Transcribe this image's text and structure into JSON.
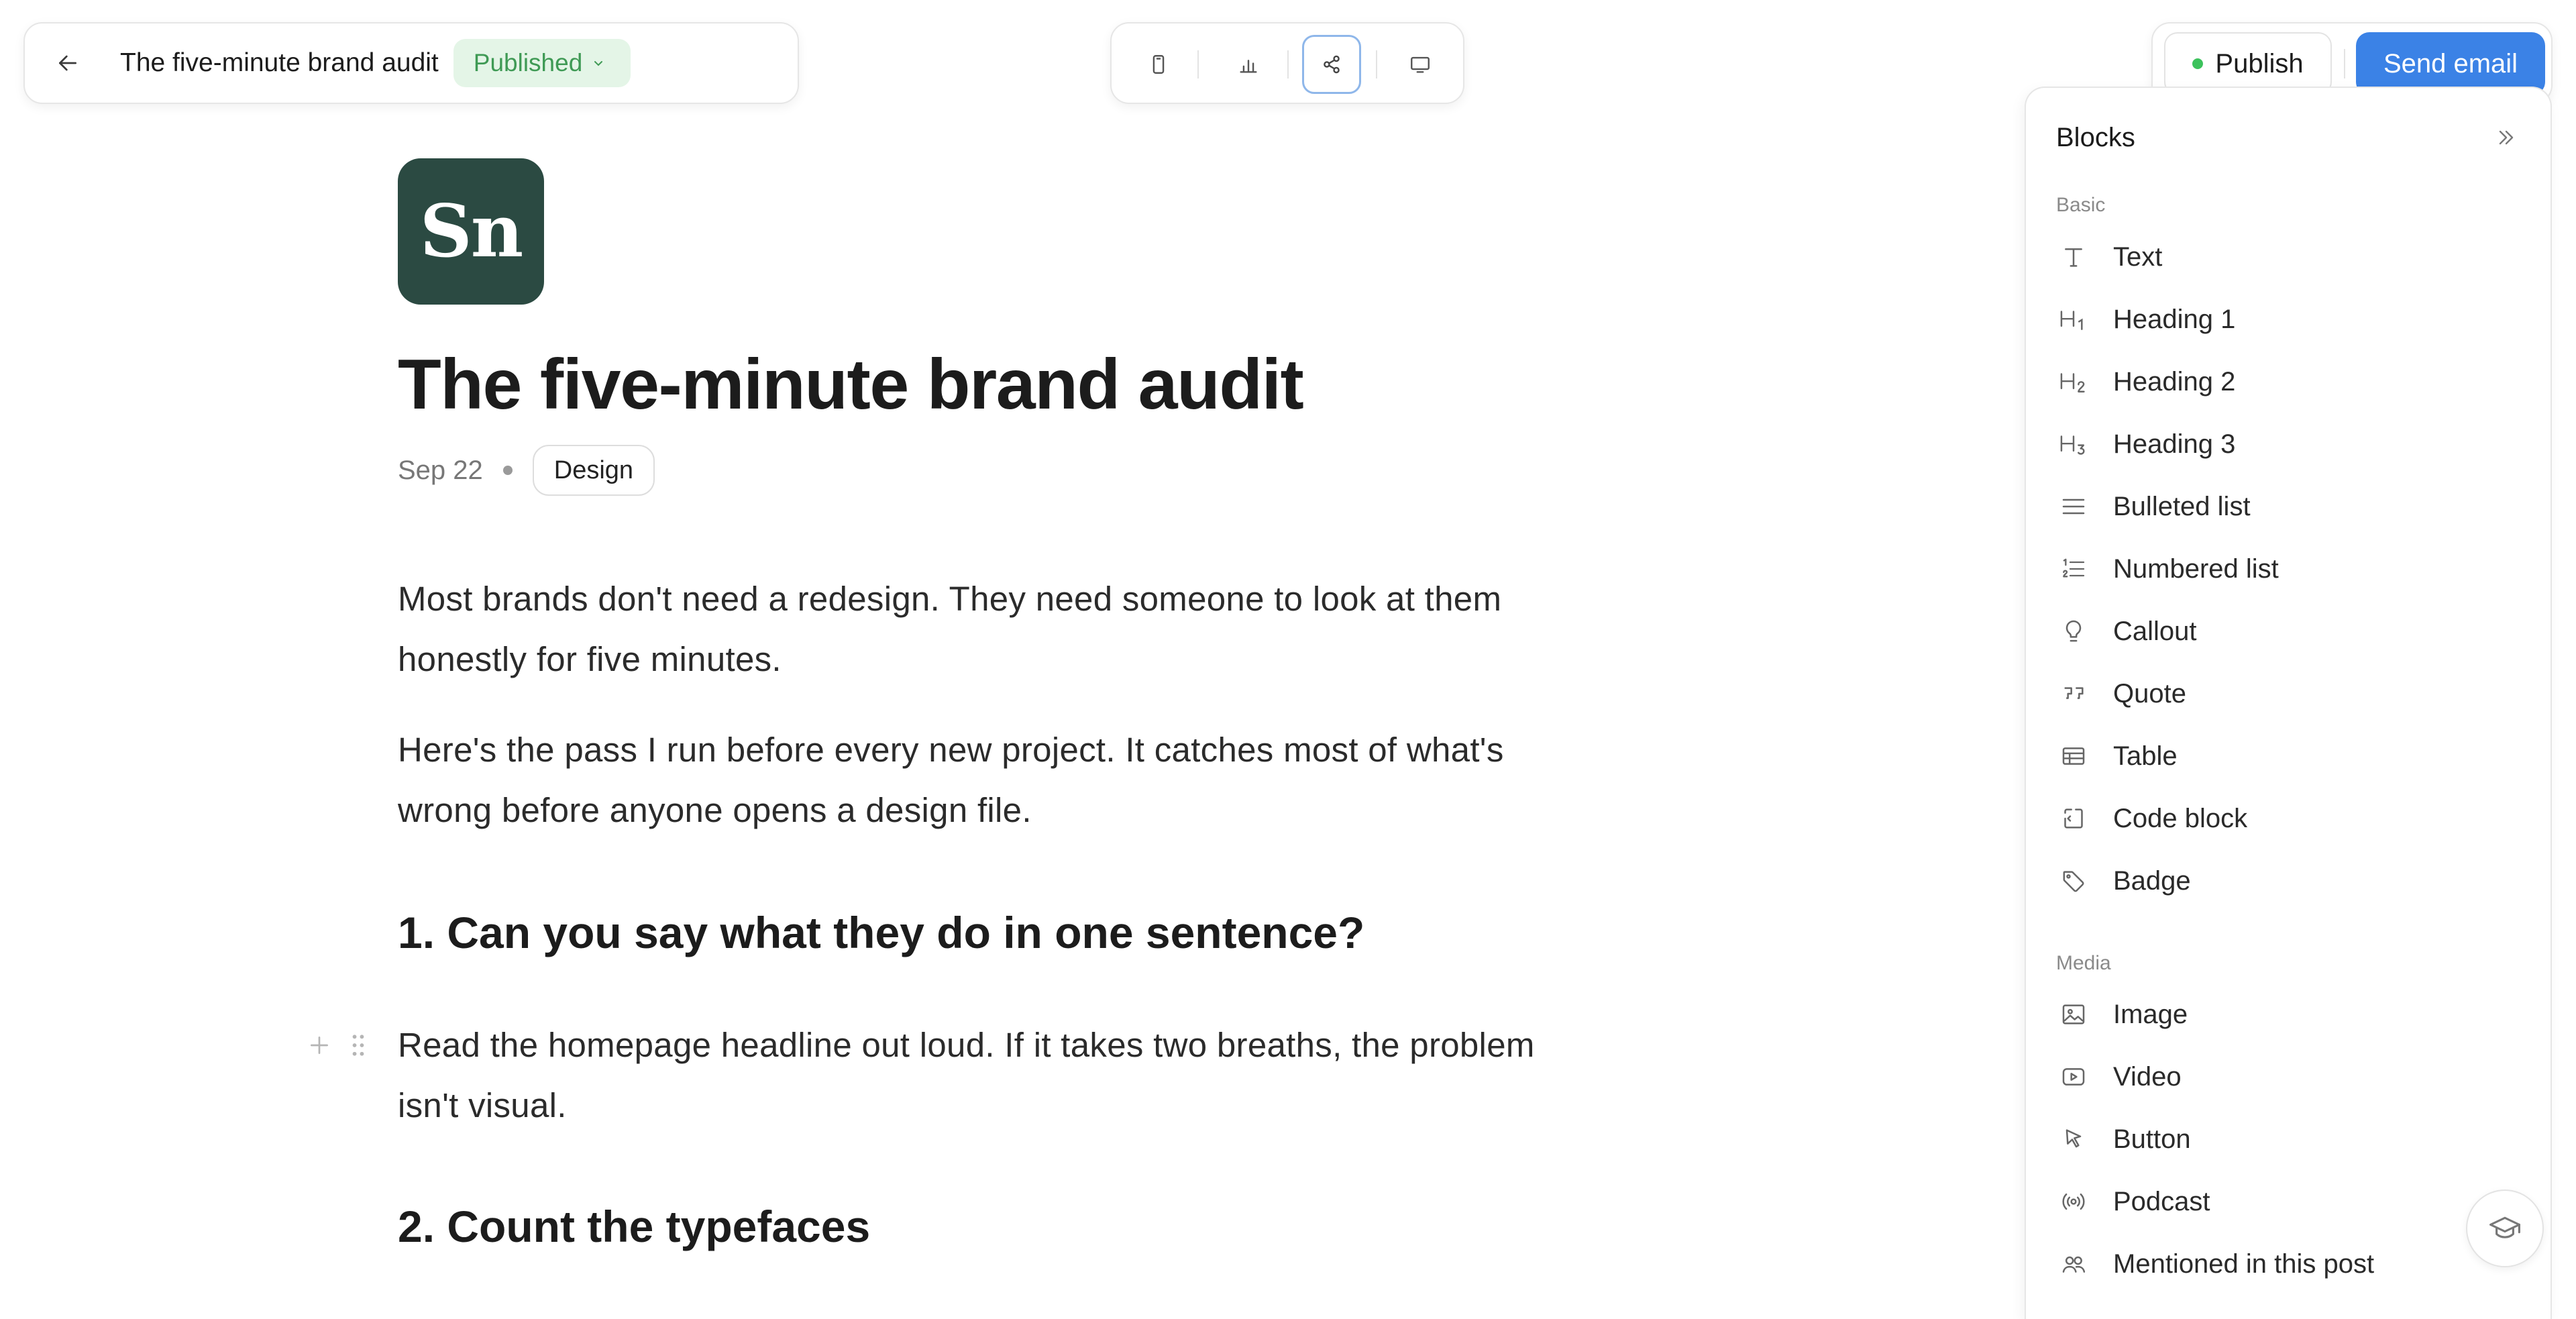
{
  "header": {
    "back_icon": "arrow-left-icon",
    "title": "The five-minute brand audit",
    "status": "Published"
  },
  "toolbar": {
    "buttons": [
      "mobile-preview-icon",
      "analytics-icon",
      "share-icon",
      "desktop-preview-icon"
    ],
    "active": "share-icon"
  },
  "actions": {
    "publish_label": "Publish",
    "send_label": "Send email",
    "accent_color": "#3b82e6",
    "live_color": "#3cc25c"
  },
  "post": {
    "logo_text": "Sn",
    "logo_color": "#2b4a42",
    "title": "The five-minute brand audit",
    "date": "Sep 22",
    "tag": "Design",
    "paragraph_1": "Most brands don't need a redesign. They need someone to look at them honestly for five minutes.",
    "paragraph_2": "Here's the pass I run before every new project. It catches most of what's wrong before anyone opens a design file.",
    "heading_1": "1. Can you say what they do in one sentence?",
    "paragraph_3": "Read the homepage headline out loud. If it takes two breaths, the problem isn't visual.",
    "heading_2": "2. Count the typefaces"
  },
  "blocks_panel": {
    "title": "Blocks",
    "basic_label": "Basic",
    "basic": [
      {
        "label": "Text",
        "icon": "text-icon"
      },
      {
        "label": "Heading 1",
        "icon": "heading-1-icon"
      },
      {
        "label": "Heading 2",
        "icon": "heading-2-icon"
      },
      {
        "label": "Heading 3",
        "icon": "heading-3-icon"
      },
      {
        "label": "Bulleted list",
        "icon": "bulleted-list-icon"
      },
      {
        "label": "Numbered list",
        "icon": "numbered-list-icon"
      },
      {
        "label": "Callout",
        "icon": "lightbulb-icon"
      },
      {
        "label": "Quote",
        "icon": "quote-icon"
      },
      {
        "label": "Table",
        "icon": "table-icon"
      },
      {
        "label": "Code block",
        "icon": "code-block-icon"
      },
      {
        "label": "Badge",
        "icon": "tag-icon"
      }
    ],
    "media_label": "Media",
    "media": [
      {
        "label": "Image",
        "icon": "image-icon"
      },
      {
        "label": "Video",
        "icon": "video-icon"
      },
      {
        "label": "Button",
        "icon": "cursor-icon"
      },
      {
        "label": "Podcast",
        "icon": "podcast-icon"
      },
      {
        "label": "Mentioned in this post",
        "icon": "people-icon"
      }
    ]
  },
  "help": {
    "icon": "graduation-cap-icon"
  }
}
